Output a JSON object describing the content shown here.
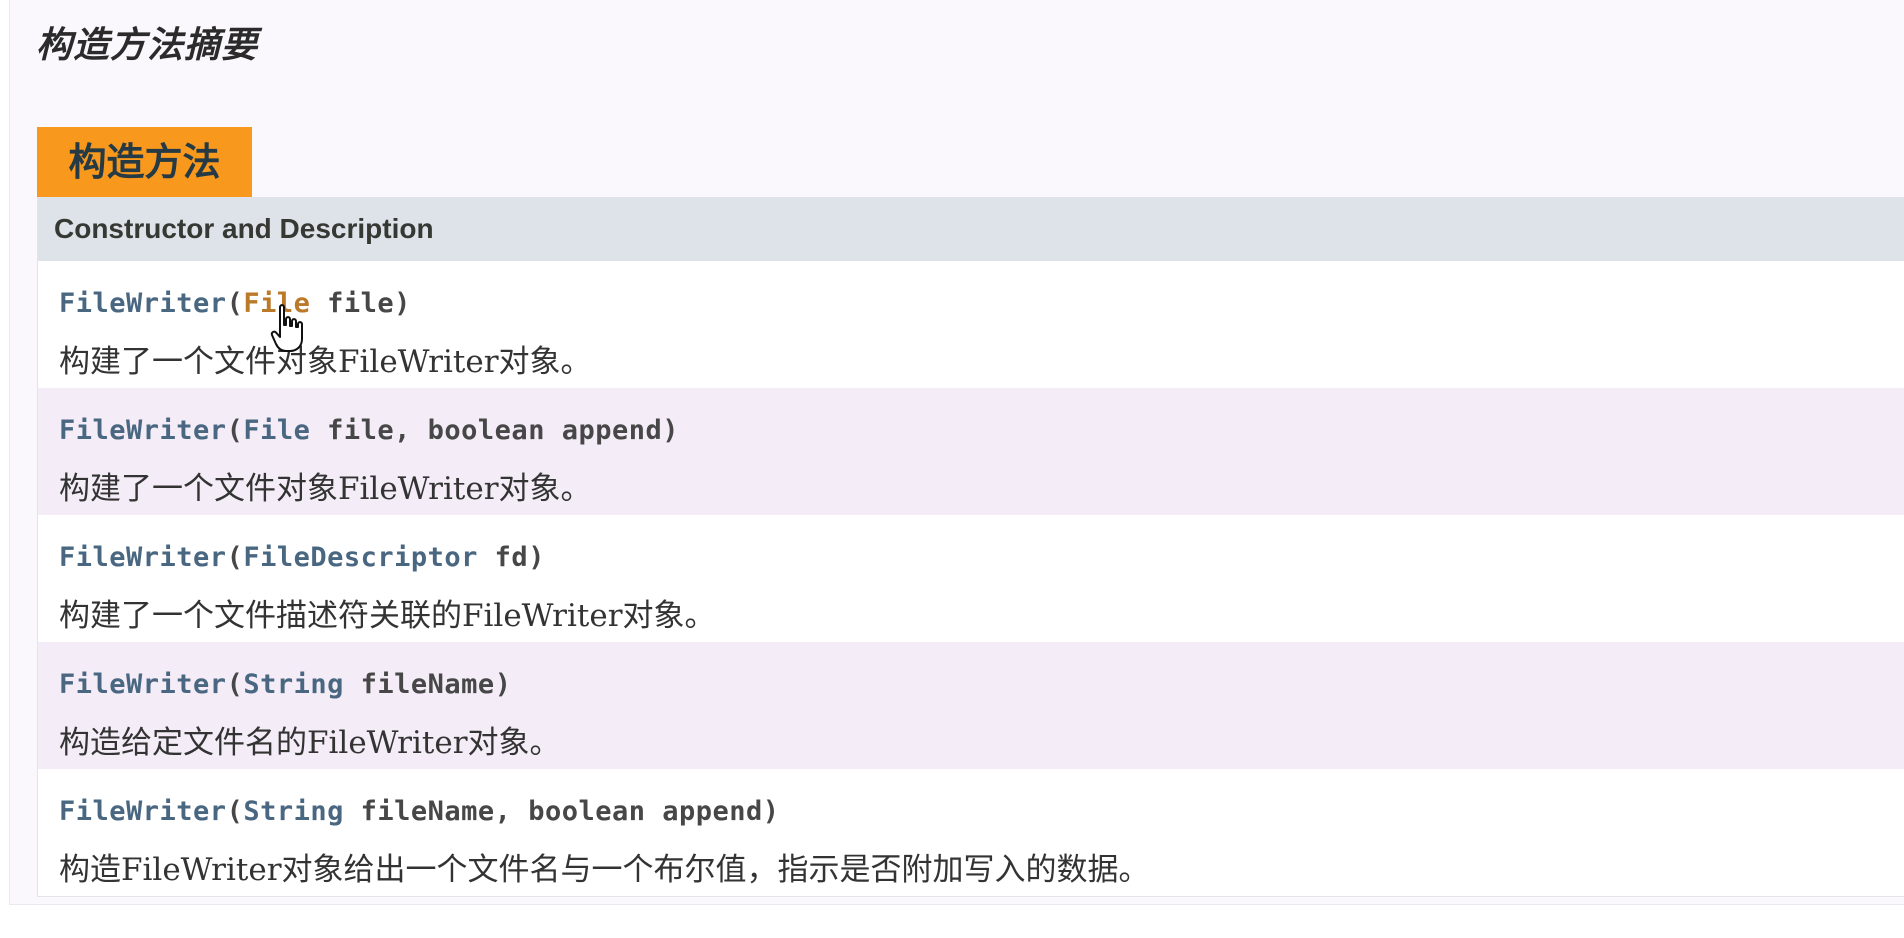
{
  "section": {
    "title": "构造方法摘要"
  },
  "caption": {
    "label": "构造方法"
  },
  "table": {
    "header": "Constructor and Description",
    "rows": [
      {
        "name": "FileWriter",
        "open": "(",
        "param_type": "File",
        "param_rest": " file",
        "param_type2": "",
        "param_rest2": "",
        "close": ")",
        "description": "构建了一个文件对象FileWriter对象。"
      },
      {
        "name": "FileWriter",
        "open": "(",
        "param_type": "File",
        "param_rest": " file, ",
        "param_type2": "boolean",
        "param_rest2": " append",
        "close": ")",
        "description": "构建了一个文件对象FileWriter对象。"
      },
      {
        "name": "FileWriter",
        "open": "(",
        "param_type": "FileDescriptor",
        "param_rest": " fd",
        "param_type2": "",
        "param_rest2": "",
        "close": ")",
        "description": "构建了一个文件描述符关联的FileWriter对象。"
      },
      {
        "name": "FileWriter",
        "open": "(",
        "param_type": "String",
        "param_rest": " fileName",
        "param_type2": "",
        "param_rest2": "",
        "close": ")",
        "description": "构造给定文件名的FileWriter对象。"
      },
      {
        "name": "FileWriter",
        "open": "(",
        "param_type": "String",
        "param_rest": " fileName, ",
        "param_type2": "boolean",
        "param_rest2": " append",
        "close": ")",
        "description": "构造FileWriter对象给出一个文件名与一个布尔值，指示是否附加写入的数据。"
      }
    ]
  },
  "colors": {
    "caption_bg": "#f8981d",
    "header_bg": "#dee3e9",
    "link": "#4a6782",
    "hover_link": "#bb7a2a",
    "row_alt_bg": "#f4ecf7"
  },
  "cursor": {
    "icon": "hand-pointer-icon"
  }
}
